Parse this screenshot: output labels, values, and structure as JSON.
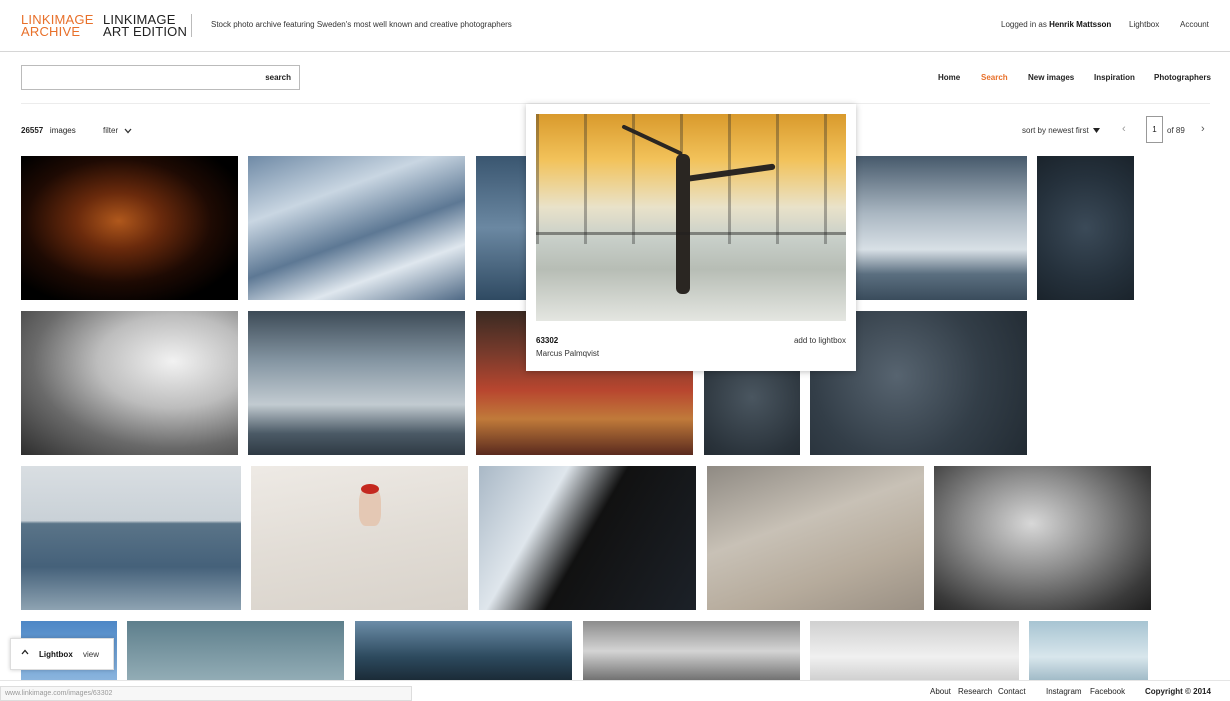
{
  "header": {
    "logo_archive": "LINKIMAGE\nARCHIVE",
    "logo_art": "LINKIMAGE\nART EDITION",
    "tagline": "Stock photo archive featuring Sweden's most well known and creative photographers",
    "logged_in_prefix": "Logged in as",
    "user_name": "Henrik Mattsson",
    "lightbox_link": "Lightbox",
    "account_link": "Account"
  },
  "search": {
    "placeholder": "",
    "value": "",
    "button_label": "search"
  },
  "nav": [
    {
      "label": "Home",
      "active": false
    },
    {
      "label": "Search",
      "active": true
    },
    {
      "label": "New images",
      "active": false
    },
    {
      "label": "Inspiration",
      "active": false
    },
    {
      "label": "Photographers",
      "active": false
    }
  ],
  "toolbar": {
    "count": "26557",
    "count_label": "images",
    "filter_label": "filter",
    "sort_label": "sort by newest first",
    "page_current": "1",
    "page_total_label": "of 89"
  },
  "popup": {
    "image_id": "63302",
    "author": "Marcus Palmqvist",
    "add_label": "add to lightbox"
  },
  "lightbox_tab": {
    "label": "Lightbox",
    "view_label": "view"
  },
  "footer": {
    "links": [
      "About",
      "Research",
      "Contact",
      "Instagram",
      "Facebook"
    ],
    "copyright": "Copyright © 2014"
  },
  "statusbar": {
    "url": "www.linkimage.com/images/63302"
  },
  "colors": {
    "accent": "#e8702a",
    "text": "#222222"
  }
}
